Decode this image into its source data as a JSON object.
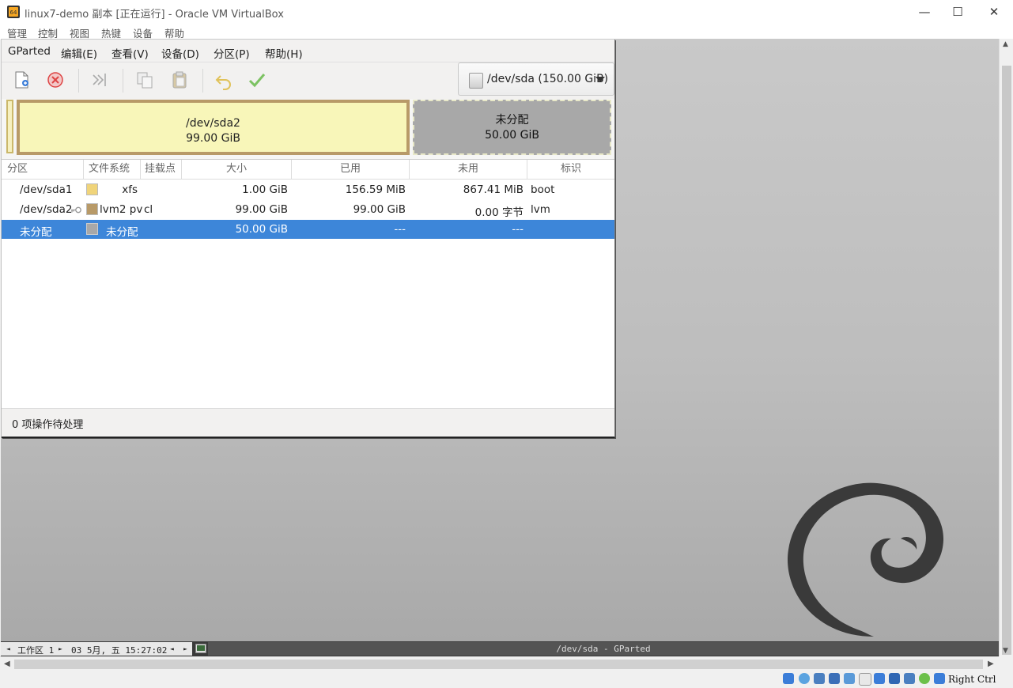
{
  "host": {
    "title": "linux7-demo 副本 [正在运行] - Oracle VM VirtualBox",
    "window_controls": {
      "minimize": "—",
      "maximize": "☐",
      "close": "✕"
    },
    "menu": [
      "管理",
      "控制",
      "视图",
      "热键",
      "设备",
      "帮助"
    ],
    "status_bar": {
      "host_key": "Right Ctrl",
      "icons": [
        "hard-disk-icon",
        "optical-drive-icon",
        "audio-icon",
        "network-icon",
        "usb-icon",
        "shared-folders-icon",
        "display-icon",
        "video-capture-icon",
        "cpu-icon",
        "mouse-integration-icon",
        "arrow-down-icon"
      ]
    }
  },
  "taskbar": {
    "left_arrow": "◄",
    "workspace": "工作区 1",
    "right_arrow": "►",
    "datetime": "03 5月, 五 15:27:02",
    "task_left": "◄",
    "task_right": "►",
    "active_task": "/dev/sda - GParted"
  },
  "gparted": {
    "menu": [
      "GParted",
      "编辑(E)",
      "查看(V)",
      "设备(D)",
      "分区(P)",
      "帮助(H)"
    ],
    "toolbar": [
      "new-icon",
      "delete-icon",
      "resize-move-icon",
      "copy-icon",
      "paste-icon",
      "undo-icon",
      "apply-icon"
    ],
    "device": "/dev/sda (150.00 GiB)",
    "disk_map": {
      "sda2": {
        "name": "/dev/sda2",
        "size": "99.00 GiB"
      },
      "unallocated": {
        "name": "未分配",
        "size": "50.00 GiB"
      }
    },
    "columns": [
      "分区",
      "文件系统",
      "挂载点",
      "大小",
      "已用",
      "未用",
      "标识"
    ],
    "rows": [
      {
        "partition": "/dev/sda1",
        "filesystem": "xfs",
        "mount": "",
        "size": "1.00 GiB",
        "used": "156.59 MiB",
        "unused": "867.41 MiB",
        "flags": "boot",
        "color": "#f0d47a",
        "key": false,
        "selected": false
      },
      {
        "partition": "/dev/sda2",
        "filesystem": "lvm2 pv",
        "mount": "cl",
        "size": "99.00 GiB",
        "used": "99.00 GiB",
        "unused": "0.00 字节",
        "flags": "lvm",
        "color": "#b89a68",
        "key": true,
        "selected": false
      },
      {
        "partition": "未分配",
        "filesystem": "未分配",
        "mount": "",
        "size": "50.00 GiB",
        "used": "---",
        "unused": "---",
        "flags": "",
        "color": "#a8a8a8",
        "key": false,
        "selected": true
      }
    ],
    "status": "0 项操作待处理"
  },
  "colors": {
    "selection": "#3d86d9",
    "sda2_border": "#b89a68",
    "sda2_fill": "#f8f6b9",
    "unallocated": "#a8a8a8"
  }
}
